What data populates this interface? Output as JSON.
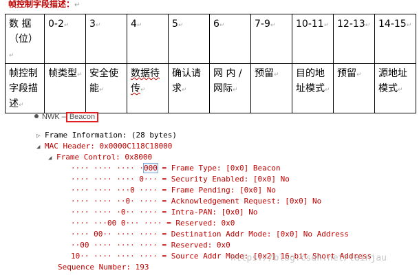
{
  "heading": {
    "text": "帧控制字段描述：",
    "mark": "↵"
  },
  "table": {
    "row1": [
      "数 据（位）",
      "0-2",
      "3",
      "4",
      "5",
      "6",
      "7-9",
      "10-11",
      "12-13",
      "14-15"
    ],
    "row2": [
      "帧控制字段描述",
      "帧类型",
      "安全使能",
      "数据待传",
      "确认请求",
      "网 内 / 网际",
      "预留",
      "目的地址模式",
      "预留",
      "源地址模式"
    ],
    "mark": "↵"
  },
  "panel": {
    "nwk_label": "NWK –",
    "nwk_selected": "Beacon",
    "lines": [
      {
        "text": "Frame Information: (28 bytes)"
      },
      {
        "text": "MAC Header: 0x0000C118C18000"
      },
      {
        "text": "Frame Control: 0x8000"
      },
      {
        "bits_pre": "···· ···· ···· ·",
        "bits_hl": "000",
        "desc": " = Frame Type: [0x0] Beacon"
      },
      {
        "bits": "···· ···· ···· 0···",
        "desc": " = Security Enabled: [0x0] No"
      },
      {
        "bits": "···· ···· ···0 ····",
        "desc": " = Frame Pending: [0x0] No"
      },
      {
        "bits": "···· ···· ··0· ····",
        "desc": " = Acknowledgement Request: [0x0] No"
      },
      {
        "bits": "···· ···· ·0·· ····",
        "desc": " = Intra-PAN: [0x0] No"
      },
      {
        "bits": "···· ···00 0··· ····",
        "desc": " = Reserved: 0x0"
      },
      {
        "bits": "···· 00·· ···· ····",
        "desc": " = Destination Addr Mode: [0x0] No Address"
      },
      {
        "bits": "··00 ···· ···· ····",
        "desc": " = Reserved: 0x0"
      },
      {
        "bits": "10·· ···· ···· ····",
        "desc": " = Source Addr Mode: [0x2] 16-bit Short Address"
      },
      {
        "text": "Sequence Number: 193"
      }
    ]
  },
  "watermark": "https://blog.csdn.net/tainjau"
}
